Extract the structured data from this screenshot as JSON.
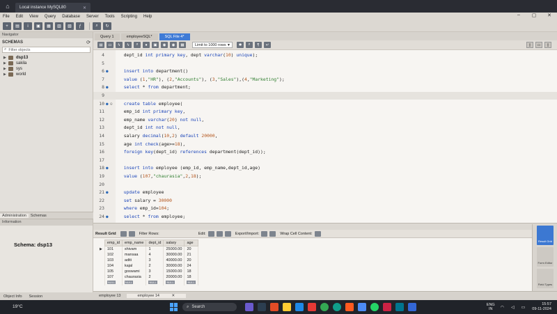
{
  "app": {
    "connection_tab": "Local instance MySQL80",
    "menu": [
      "File",
      "Edit",
      "View",
      "Query",
      "Database",
      "Server",
      "Tools",
      "Scripting",
      "Help"
    ]
  },
  "sidebar": {
    "navigator_label": "Navigator",
    "schemas_label": "SCHEMAS",
    "filter_placeholder": "Filter objects",
    "schemas": [
      "dsp13",
      "sakila",
      "sys",
      "world"
    ],
    "tabs": [
      "Administration",
      "Schemas"
    ],
    "info_label": "Information",
    "schema_info": "Schema: dsp13",
    "bottom_tabs": [
      "Object Info",
      "Session"
    ]
  },
  "query_tabs": [
    "Query 1",
    "employeeSQL*",
    "SQL File 4*"
  ],
  "editor_toolbar": {
    "limit_label": "Limit to 1000 rows"
  },
  "editor": {
    "lines": [
      {
        "num": "4",
        "dot": false,
        "fold": false,
        "text": "  dept_id int primary key, dept varchar(10) unique);"
      },
      {
        "num": "5",
        "dot": false,
        "fold": false,
        "text": ""
      },
      {
        "num": "6",
        "dot": true,
        "fold": false,
        "text": "  insert into department()"
      },
      {
        "num": "7",
        "dot": false,
        "fold": false,
        "text": "  value (1,\"HR\"), (2,\"Accounts\"), (3,\"Sales\"),(4,\"Marketing\");"
      },
      {
        "num": "8",
        "dot": true,
        "fold": false,
        "text": "  select * from department;"
      },
      {
        "num": "9",
        "dot": false,
        "fold": false,
        "text": ""
      },
      {
        "num": "10",
        "dot": true,
        "fold": true,
        "text": "  create table employee("
      },
      {
        "num": "11",
        "dot": false,
        "fold": false,
        "text": "  emp_id int primary key,"
      },
      {
        "num": "12",
        "dot": false,
        "fold": false,
        "text": "  emp_name varchar(20) not null,"
      },
      {
        "num": "13",
        "dot": false,
        "fold": false,
        "text": "  dept_id int not null,"
      },
      {
        "num": "14",
        "dot": false,
        "fold": false,
        "text": "  salary decimal(10,2) default 20000,"
      },
      {
        "num": "15",
        "dot": false,
        "fold": false,
        "text": "  age int check(age>=18),"
      },
      {
        "num": "16",
        "dot": false,
        "fold": false,
        "text": "  foreign key(dept_id) references department(dept_id));"
      },
      {
        "num": "17",
        "dot": false,
        "fold": false,
        "text": ""
      },
      {
        "num": "18",
        "dot": true,
        "fold": false,
        "text": "  insert into employee (emp_id, emp_name,dept_id,age)"
      },
      {
        "num": "19",
        "dot": false,
        "fold": false,
        "text": "  value (107,\"chaurasia\",2,18);"
      },
      {
        "num": "20",
        "dot": false,
        "fold": false,
        "text": ""
      },
      {
        "num": "21",
        "dot": true,
        "fold": false,
        "text": "  update employee"
      },
      {
        "num": "22",
        "dot": false,
        "fold": false,
        "text": "  set salary = 30000"
      },
      {
        "num": "23",
        "dot": false,
        "fold": false,
        "text": "  where emp_id=104;"
      },
      {
        "num": "24",
        "dot": true,
        "fold": false,
        "text": "  select * from employee;"
      }
    ]
  },
  "result": {
    "title": "Result Grid",
    "filter_label": "Filter Rows:",
    "edit_label": "Edit:",
    "export_label": "Export/Import:",
    "wrap_label": "Wrap Cell Content:",
    "columns": [
      "emp_id",
      "emp_name",
      "dept_id",
      "salary",
      "age"
    ],
    "rows": [
      [
        "101",
        "shivam",
        "1",
        "25000.00",
        "20"
      ],
      [
        "102",
        "mansaa",
        "4",
        "30000.00",
        "21"
      ],
      [
        "103",
        "aditi",
        "3",
        "40000.00",
        "20"
      ],
      [
        "104",
        "kajal",
        "2",
        "30000.00",
        "24"
      ],
      [
        "105",
        "goswami",
        "3",
        "15000.00",
        "18"
      ],
      [
        "107",
        "chaurasia",
        "2",
        "20000.00",
        "18"
      ]
    ],
    "null_label": "NULL",
    "output_tabs": [
      "employee 13",
      "employee 14"
    ],
    "rail_buttons": [
      "Result Grid",
      "Form Editor",
      "Field Types"
    ]
  },
  "taskbar": {
    "weather": "19°C",
    "search": "Search",
    "lang": [
      "ENG",
      "IN"
    ],
    "time": "15:57",
    "date": "09-11-2024"
  }
}
